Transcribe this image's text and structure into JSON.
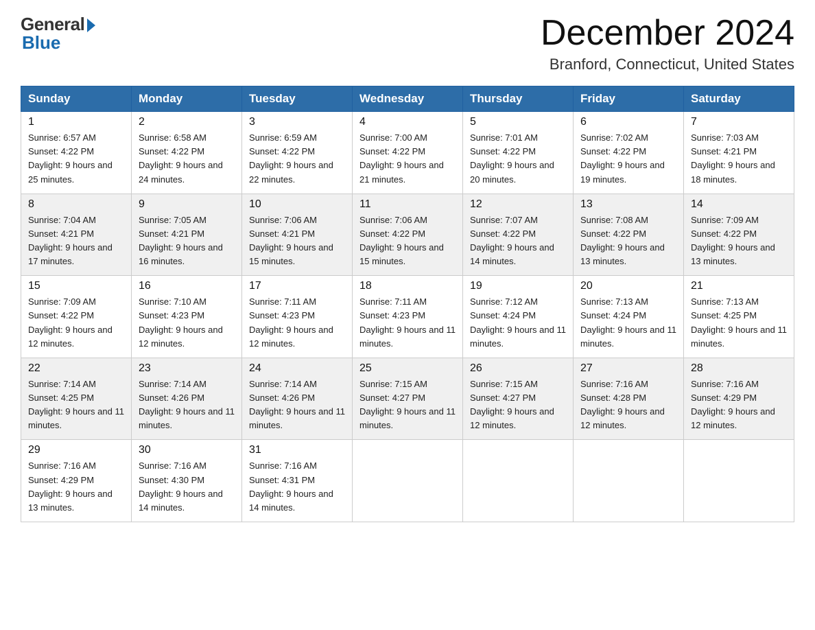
{
  "header": {
    "logo_general": "General",
    "logo_blue": "Blue",
    "month_title": "December 2024",
    "location": "Branford, Connecticut, United States"
  },
  "days_of_week": [
    "Sunday",
    "Monday",
    "Tuesday",
    "Wednesday",
    "Thursday",
    "Friday",
    "Saturday"
  ],
  "weeks": [
    [
      {
        "day": "1",
        "sunrise": "6:57 AM",
        "sunset": "4:22 PM",
        "daylight": "9 hours and 25 minutes."
      },
      {
        "day": "2",
        "sunrise": "6:58 AM",
        "sunset": "4:22 PM",
        "daylight": "9 hours and 24 minutes."
      },
      {
        "day": "3",
        "sunrise": "6:59 AM",
        "sunset": "4:22 PM",
        "daylight": "9 hours and 22 minutes."
      },
      {
        "day": "4",
        "sunrise": "7:00 AM",
        "sunset": "4:22 PM",
        "daylight": "9 hours and 21 minutes."
      },
      {
        "day": "5",
        "sunrise": "7:01 AM",
        "sunset": "4:22 PM",
        "daylight": "9 hours and 20 minutes."
      },
      {
        "day": "6",
        "sunrise": "7:02 AM",
        "sunset": "4:22 PM",
        "daylight": "9 hours and 19 minutes."
      },
      {
        "day": "7",
        "sunrise": "7:03 AM",
        "sunset": "4:21 PM",
        "daylight": "9 hours and 18 minutes."
      }
    ],
    [
      {
        "day": "8",
        "sunrise": "7:04 AM",
        "sunset": "4:21 PM",
        "daylight": "9 hours and 17 minutes."
      },
      {
        "day": "9",
        "sunrise": "7:05 AM",
        "sunset": "4:21 PM",
        "daylight": "9 hours and 16 minutes."
      },
      {
        "day": "10",
        "sunrise": "7:06 AM",
        "sunset": "4:21 PM",
        "daylight": "9 hours and 15 minutes."
      },
      {
        "day": "11",
        "sunrise": "7:06 AM",
        "sunset": "4:22 PM",
        "daylight": "9 hours and 15 minutes."
      },
      {
        "day": "12",
        "sunrise": "7:07 AM",
        "sunset": "4:22 PM",
        "daylight": "9 hours and 14 minutes."
      },
      {
        "day": "13",
        "sunrise": "7:08 AM",
        "sunset": "4:22 PM",
        "daylight": "9 hours and 13 minutes."
      },
      {
        "day": "14",
        "sunrise": "7:09 AM",
        "sunset": "4:22 PM",
        "daylight": "9 hours and 13 minutes."
      }
    ],
    [
      {
        "day": "15",
        "sunrise": "7:09 AM",
        "sunset": "4:22 PM",
        "daylight": "9 hours and 12 minutes."
      },
      {
        "day": "16",
        "sunrise": "7:10 AM",
        "sunset": "4:23 PM",
        "daylight": "9 hours and 12 minutes."
      },
      {
        "day": "17",
        "sunrise": "7:11 AM",
        "sunset": "4:23 PM",
        "daylight": "9 hours and 12 minutes."
      },
      {
        "day": "18",
        "sunrise": "7:11 AM",
        "sunset": "4:23 PM",
        "daylight": "9 hours and 11 minutes."
      },
      {
        "day": "19",
        "sunrise": "7:12 AM",
        "sunset": "4:24 PM",
        "daylight": "9 hours and 11 minutes."
      },
      {
        "day": "20",
        "sunrise": "7:13 AM",
        "sunset": "4:24 PM",
        "daylight": "9 hours and 11 minutes."
      },
      {
        "day": "21",
        "sunrise": "7:13 AM",
        "sunset": "4:25 PM",
        "daylight": "9 hours and 11 minutes."
      }
    ],
    [
      {
        "day": "22",
        "sunrise": "7:14 AM",
        "sunset": "4:25 PM",
        "daylight": "9 hours and 11 minutes."
      },
      {
        "day": "23",
        "sunrise": "7:14 AM",
        "sunset": "4:26 PM",
        "daylight": "9 hours and 11 minutes."
      },
      {
        "day": "24",
        "sunrise": "7:14 AM",
        "sunset": "4:26 PM",
        "daylight": "9 hours and 11 minutes."
      },
      {
        "day": "25",
        "sunrise": "7:15 AM",
        "sunset": "4:27 PM",
        "daylight": "9 hours and 11 minutes."
      },
      {
        "day": "26",
        "sunrise": "7:15 AM",
        "sunset": "4:27 PM",
        "daylight": "9 hours and 12 minutes."
      },
      {
        "day": "27",
        "sunrise": "7:16 AM",
        "sunset": "4:28 PM",
        "daylight": "9 hours and 12 minutes."
      },
      {
        "day": "28",
        "sunrise": "7:16 AM",
        "sunset": "4:29 PM",
        "daylight": "9 hours and 12 minutes."
      }
    ],
    [
      {
        "day": "29",
        "sunrise": "7:16 AM",
        "sunset": "4:29 PM",
        "daylight": "9 hours and 13 minutes."
      },
      {
        "day": "30",
        "sunrise": "7:16 AM",
        "sunset": "4:30 PM",
        "daylight": "9 hours and 14 minutes."
      },
      {
        "day": "31",
        "sunrise": "7:16 AM",
        "sunset": "4:31 PM",
        "daylight": "9 hours and 14 minutes."
      },
      null,
      null,
      null,
      null
    ]
  ]
}
